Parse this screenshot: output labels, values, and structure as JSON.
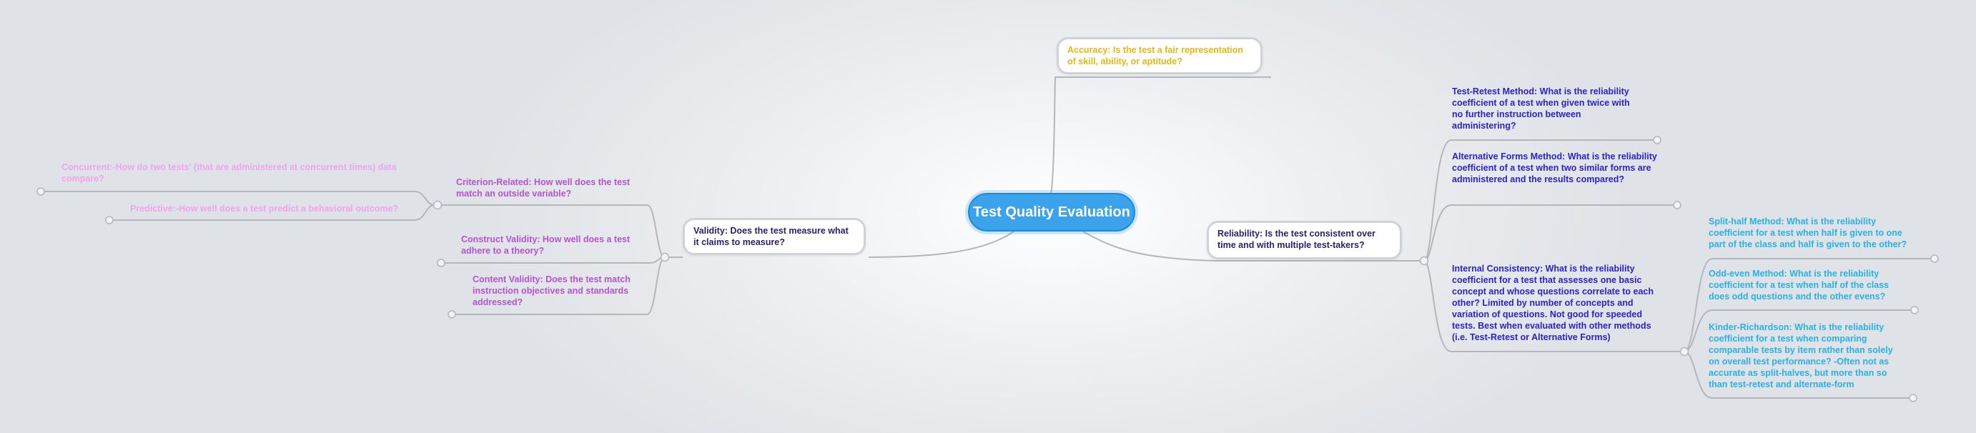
{
  "central": {
    "title": "Test Quality Evaluation"
  },
  "accuracy": {
    "label": "Accuracy:  Is the test a fair representation of skill, ability, or aptitude?"
  },
  "reliability": {
    "label": "Reliability:  Is the test consistent over time and with multiple test-takers?",
    "test_retest": "Test-Retest Method: What is the reliability coefficient of a test when given twice with no further instruction between administering?",
    "alternative_forms": "Alternative Forms Method:  What is the reliability coefficient of a test when two similar forms are administered and the results compared?",
    "internal_consistency": "Internal Consistency:  What is the reliability coefficient for a test that assesses one basic concept and whose questions correlate to each other? Limited by number of concepts and variation of questions.   Not good for speeded tests.  Best when evaluated with other methods (i.e. Test-Retest or Alternative Forms)",
    "split_half": "Split-half Method: What is the reliability coefficient for a test when half is given to one part of the class and half is given to the other?",
    "odd_even": "Odd-even Method:  What is the reliability coefficient for a test when half of the class does odd questions and the other evens?",
    "kinder_richardson": "Kinder-Richardson:  What is the reliability coefficient for a test when comparing comparable tests by item rather than solely on overall test performance? -Often not as accurate as split-halves, but more than so than test-retest and alternate-form"
  },
  "validity": {
    "label": "Validity:  Does the test measure what it claims to measure?",
    "criterion": "Criterion-Related:  How well does the test match an outside variable?",
    "concurrent": "Concurrent:-How do two tests' (that are administered at concurrent times) data compare?",
    "predictive": "Predictive:-How well does a test predict a behavioral outcome?",
    "construct": "Construct Validity:  How well does a test adhere to a theory?",
    "content": "Content Validity:  Does the test match instruction objectives and standards addressed?"
  },
  "colors": {
    "central": "#3aa3ec",
    "accuracy": "#e4b810",
    "dark": "#2a1f6a",
    "blue": "#2d22c6",
    "cyan": "#2ab1e4",
    "purple": "#b255cd",
    "pink": "#f2a3f0",
    "connector": "#b3b6ba"
  }
}
